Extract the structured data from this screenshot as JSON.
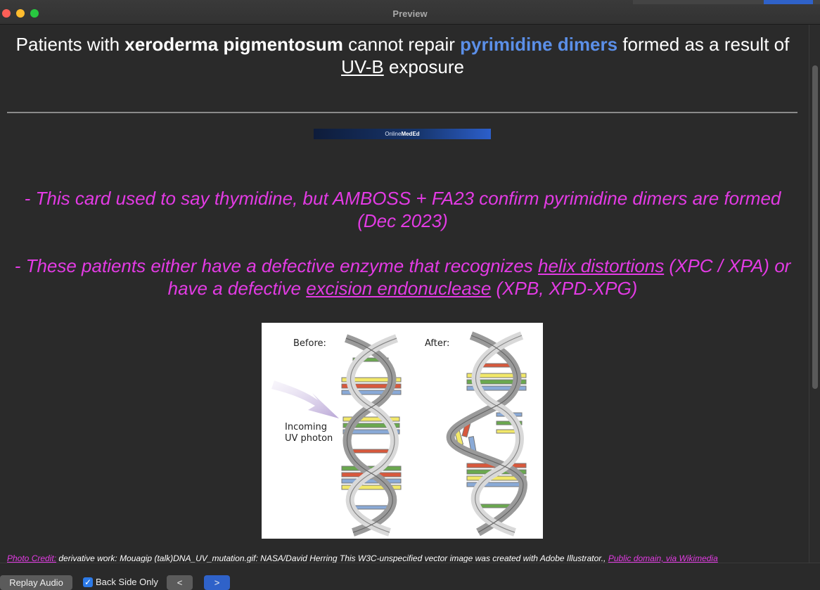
{
  "window": {
    "title": "Preview"
  },
  "front": {
    "part1": "Patients with ",
    "bold1": "xeroderma pigmentosum",
    "part2": " cannot repair ",
    "highlight": "pyrimidine dimers",
    "part3": " formed as a result of ",
    "underlined": "UV-B",
    "part4": " exposure"
  },
  "logo": {
    "text_a": "Online",
    "text_b": "MedEd"
  },
  "notes": {
    "note1": "- This card used to say thymidine, but AMBOSS + FA23 confirm pyrimidine dimers are formed (Dec 2023)",
    "note2_a": "- These patients either have a defective enzyme that recognizes ",
    "note2_u1": "helix distortions",
    "note2_b": " (XPC / XPA) or have a defective ",
    "note2_u2": "excision endonuclease",
    "note2_c": " (XPB, XPD-XPG)"
  },
  "figure": {
    "label_before": "Before:",
    "label_after": "After:",
    "label_incoming_1": "Incoming",
    "label_incoming_2": "UV photon"
  },
  "credit": {
    "label": "Photo Credit:",
    "text": " derivative work: Mouagip (talk)DNA_UV_mutation.gif: NASA/David Herring This W3C-unspecified vector image was created with Adobe Illustrator., ",
    "link": "Public domain, via Wikimedia"
  },
  "bottom": {
    "replay": "Replay Audio",
    "back_only": "Back Side Only",
    "prev": "<",
    "next": ">"
  },
  "colors": {
    "accent_blue": "#5b8fe8",
    "note_magenta": "#e33be4",
    "background": "#2a2a2a"
  }
}
